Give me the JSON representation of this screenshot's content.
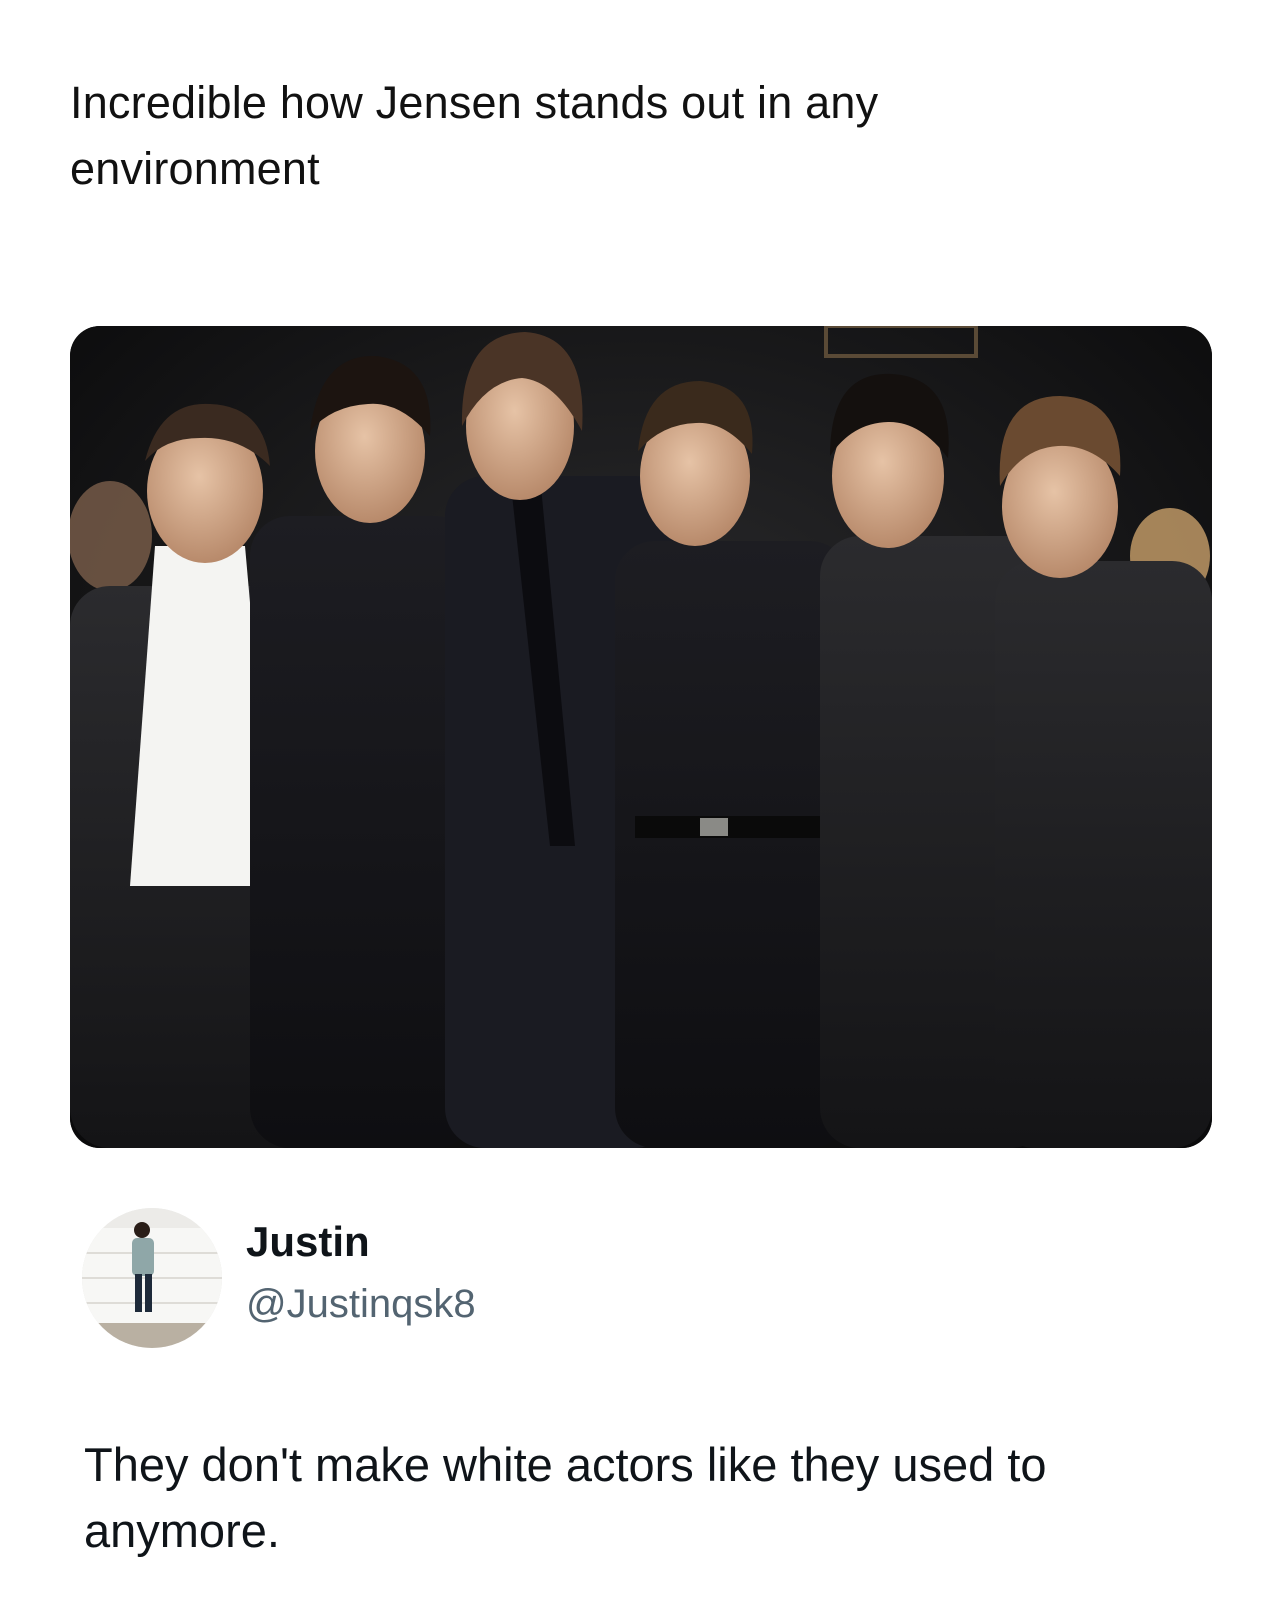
{
  "post": {
    "caption": "Incredible how Jensen stands out in any environment",
    "image_alt": "Group photo of six men in dark suits standing together at an event"
  },
  "tweet": {
    "author_name": "Justin",
    "author_handle": "@Justinqsk8",
    "text": "They don't make white actors like they used to anymore."
  },
  "colors": {
    "text_primary": "#0f1419",
    "text_secondary": "#536471",
    "background": "#ffffff"
  }
}
